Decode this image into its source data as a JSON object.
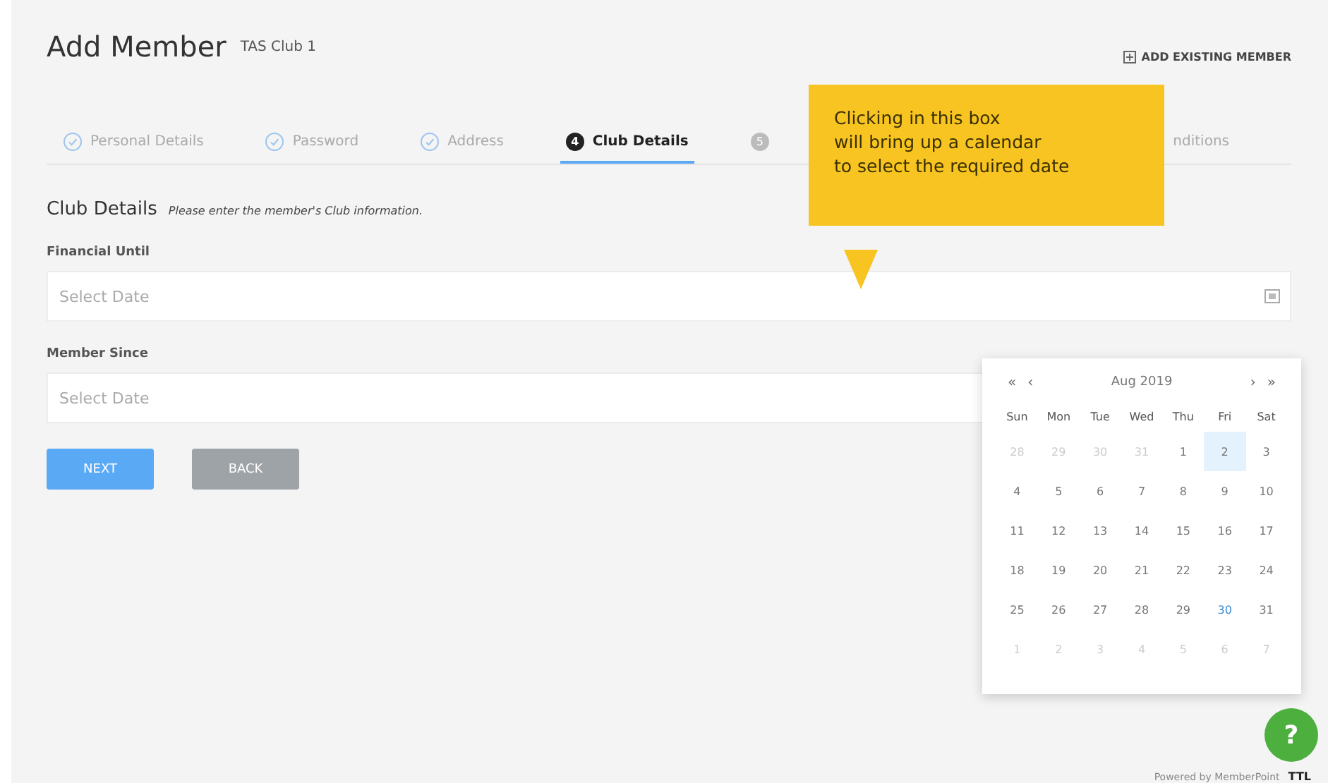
{
  "header": {
    "title": "Add Member",
    "subtitle": "TAS Club 1",
    "action": "ADD EXISTING MEMBER"
  },
  "steps": [
    {
      "label": "Personal Details",
      "kind": "done",
      "selected": false
    },
    {
      "label": "Password",
      "kind": "done",
      "selected": false
    },
    {
      "label": "Address",
      "kind": "done",
      "selected": false
    },
    {
      "number": "4",
      "label": "Club Details",
      "kind": "current",
      "selected": true
    },
    {
      "number": "5",
      "kind": "todo",
      "selected": false
    },
    {
      "label": "nditions",
      "kind": "todo",
      "selected": false
    }
  ],
  "section": {
    "title": "Club Details",
    "hint": "Please enter the member's Club information."
  },
  "fields": [
    {
      "label": "Financial Until",
      "placeholder": "Select Date",
      "calendar_icon": true
    },
    {
      "label": "Member Since",
      "placeholder": "Select Date"
    }
  ],
  "buttons": [
    {
      "label": "NEXT",
      "kind": "primary"
    },
    {
      "label": "BACK",
      "kind": "secondary"
    }
  ],
  "callout": {
    "text": "Clicking in this box\nwill bring up a calendar\nto select the required date"
  },
  "calendar": {
    "first": "«",
    "prev": "‹",
    "month": "Aug 2019",
    "next": "›",
    "last": "»",
    "weekdays": [
      "Sun",
      "Mon",
      "Tue",
      "Wed",
      "Thu",
      "Fri",
      "Sat"
    ],
    "weeks": [
      [
        {
          "day": "28",
          "kind": "other"
        },
        {
          "day": "29",
          "kind": "other"
        },
        {
          "day": "30",
          "kind": "other"
        },
        {
          "day": "31",
          "kind": "other"
        },
        {
          "day": "1",
          "kind": "day"
        },
        {
          "day": "2",
          "kind": "selected"
        },
        {
          "day": "3",
          "kind": "day"
        }
      ],
      [
        {
          "day": "4",
          "kind": "day"
        },
        {
          "day": "5",
          "kind": "day"
        },
        {
          "day": "6",
          "kind": "day"
        },
        {
          "day": "7",
          "kind": "day"
        },
        {
          "day": "8",
          "kind": "day"
        },
        {
          "day": "9",
          "kind": "day"
        },
        {
          "day": "10",
          "kind": "day"
        }
      ],
      [
        {
          "day": "11",
          "kind": "day"
        },
        {
          "day": "12",
          "kind": "day"
        },
        {
          "day": "13",
          "kind": "day"
        },
        {
          "day": "14",
          "kind": "day"
        },
        {
          "day": "15",
          "kind": "day"
        },
        {
          "day": "16",
          "kind": "day"
        },
        {
          "day": "17",
          "kind": "day"
        }
      ],
      [
        {
          "day": "18",
          "kind": "day"
        },
        {
          "day": "19",
          "kind": "day"
        },
        {
          "day": "20",
          "kind": "day"
        },
        {
          "day": "21",
          "kind": "day"
        },
        {
          "day": "22",
          "kind": "day"
        },
        {
          "day": "23",
          "kind": "day"
        },
        {
          "day": "24",
          "kind": "day"
        }
      ],
      [
        {
          "day": "25",
          "kind": "day"
        },
        {
          "day": "26",
          "kind": "day"
        },
        {
          "day": "27",
          "kind": "day"
        },
        {
          "day": "28",
          "kind": "day"
        },
        {
          "day": "29",
          "kind": "day"
        },
        {
          "day": "30",
          "kind": "today"
        },
        {
          "day": "31",
          "kind": "day"
        }
      ],
      [
        {
          "day": "1",
          "kind": "other"
        },
        {
          "day": "2",
          "kind": "other"
        },
        {
          "day": "3",
          "kind": "other"
        },
        {
          "day": "4",
          "kind": "other"
        },
        {
          "day": "5",
          "kind": "other"
        },
        {
          "day": "6",
          "kind": "other"
        },
        {
          "day": "7",
          "kind": "other"
        }
      ]
    ]
  },
  "help": {
    "label": "?"
  },
  "footer": {
    "text": "Powered by MemberPoint",
    "logo": "TTL"
  }
}
